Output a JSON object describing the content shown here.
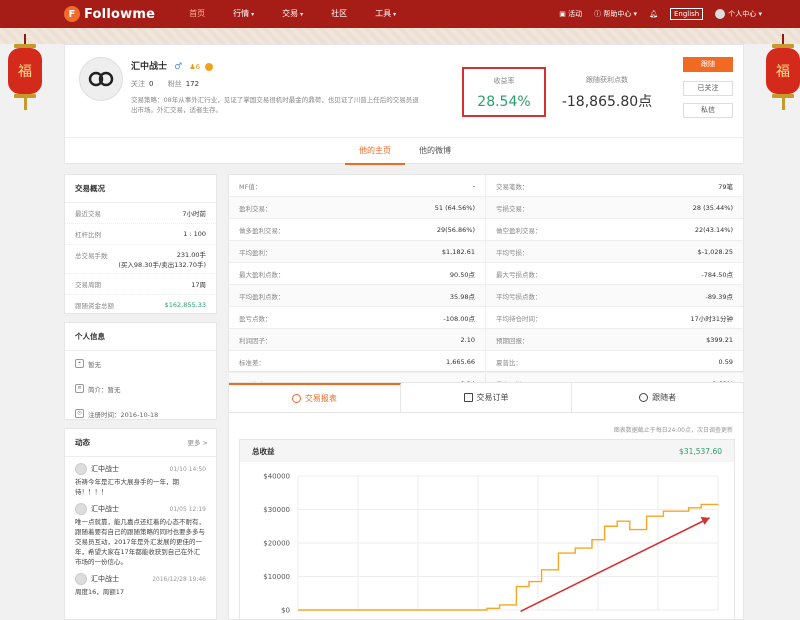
{
  "header": {
    "logo": "Followme",
    "nav": [
      {
        "label": "首页",
        "active": true
      },
      {
        "label": "行情",
        "caret": true
      },
      {
        "label": "交易",
        "caret": true
      },
      {
        "label": "社区"
      },
      {
        "label": "工具",
        "caret": true
      }
    ],
    "activity": "活动",
    "help": "帮助中心",
    "language": "English",
    "user_center": "个人中心"
  },
  "lanterns": [
    "福",
    "福"
  ],
  "profile": {
    "name": "汇中战士",
    "gender_icon": "♂",
    "level": "6",
    "follow_label": "关注",
    "follow_count": "0",
    "fans_label": "粉丝",
    "fans_count": "172",
    "description": "交易策略：08年从事外汇行业，见证了掌国交易很机时最金的鼎荷，也见证了川普上任后的交易员退出市场。外汇交易，适者生存。",
    "yield_label": "收益率",
    "yield_value": "28.54%",
    "pl_label": "跟随获利点数",
    "pl_value": "-18,865.80点",
    "btn_follow": "跟随",
    "btn_followed": "已关注",
    "btn_message": "私信",
    "tabs": [
      "他的主页",
      "他的微博"
    ]
  },
  "overview": {
    "title": "交易概况",
    "rows": [
      {
        "k": "最近交易",
        "v": "7小时前"
      },
      {
        "k": "杠杆比例",
        "v": "1 : 100"
      },
      {
        "k": "总交易手数",
        "v": "231.00手",
        "v2": "(买入98.30手/卖出132.70手)"
      },
      {
        "k": "交易周期",
        "v": "17周"
      },
      {
        "k": "跟随资金总额",
        "v": "$162,855.33",
        "green": true
      }
    ]
  },
  "personal": {
    "title": "个人信息",
    "rows": [
      "暂无",
      "简介：暂无",
      "注册时间：2016-10-18"
    ]
  },
  "feed": {
    "title": "动态",
    "more": "更多 >",
    "posts": [
      {
        "user": "汇中战士",
        "time": "01/10 14:50",
        "text": "祈祷今年是汇市大展身手的一年，期待！！！！"
      },
      {
        "user": "汇中战士",
        "time": "01/05 12:19",
        "text": "唯一点就靠，能几嘉点还红着的心态不耐有，跟随着要有自己的跟随策略的同时也要多多与交易员互动，2017年是外汇发展的更佳的一年，希望大家在17年都能收获到自己在外汇市场的一份信心。"
      },
      {
        "user": "汇中战士",
        "time": "2016/12/28 19:46",
        "text": "周度16，周额17"
      }
    ]
  },
  "stats": {
    "rows": [
      [
        {
          "k": "MF值：",
          "v": "-"
        },
        {
          "k": "交易笔数：",
          "v": "79笔"
        }
      ],
      [
        {
          "k": "盈利交易：",
          "v": "51 (64.56%)"
        },
        {
          "k": "亏损交易：",
          "v": "28 (35.44%)"
        }
      ],
      [
        {
          "k": "做多盈利交易：",
          "v": "29(56.86%)"
        },
        {
          "k": "做空盈利交易：",
          "v": "22(43.14%)"
        }
      ],
      [
        {
          "k": "平均盈利：",
          "v": "$1,182.61"
        },
        {
          "k": "平均亏损：",
          "v": "$-1,028.25"
        }
      ],
      [
        {
          "k": "最大盈利点数：",
          "v": "90.50点"
        },
        {
          "k": "最大亏损点数：",
          "v": "-784.50点"
        }
      ],
      [
        {
          "k": "平均盈利点数：",
          "v": "35.98点"
        },
        {
          "k": "平均亏损点数：",
          "v": "-89.39点"
        }
      ],
      [
        {
          "k": "盈亏点数：",
          "v": "-108.00点"
        },
        {
          "k": "平均持仓时间：",
          "v": "17小时31分钟"
        }
      ],
      [
        {
          "k": "利润因子：",
          "v": "2.10"
        },
        {
          "k": "预期回报：",
          "v": "$399.21"
        }
      ],
      [
        {
          "k": "标准差：",
          "v": "1,665.66"
        },
        {
          "k": "夏普比：",
          "v": "0.59"
        }
      ],
      [
        {
          "k": "盈亏比率：",
          "v": "0.24"
        },
        {
          "k": "最大回撤：",
          "v": "-1.62%"
        }
      ]
    ]
  },
  "bottom": {
    "tabs": [
      "交易报表",
      "交易订单",
      "跟随者"
    ],
    "note": "图表数据截止于每日24:00点，次日调查更新",
    "chart_title": "总收益",
    "chart_total": "$31,537.60"
  },
  "chart_data": {
    "type": "line",
    "title": "总收益",
    "y_ticks": [
      "$40000",
      "$30000",
      "$20000",
      "$10000",
      "$0"
    ],
    "ylim": [
      0,
      40000
    ],
    "color": "#f5a623",
    "x": [
      0,
      0.4,
      0.45,
      0.48,
      0.52,
      0.55,
      0.58,
      0.62,
      0.66,
      0.7,
      0.73,
      0.76,
      0.79,
      0.83,
      0.87,
      0.9,
      0.93,
      0.96,
      1.0
    ],
    "values": [
      0,
      0,
      500,
      1500,
      7000,
      8500,
      12000,
      17000,
      18500,
      21000,
      25000,
      26500,
      24000,
      28000,
      29500,
      29500,
      30500,
      31500,
      31537.6
    ],
    "annotation": "arrow"
  }
}
